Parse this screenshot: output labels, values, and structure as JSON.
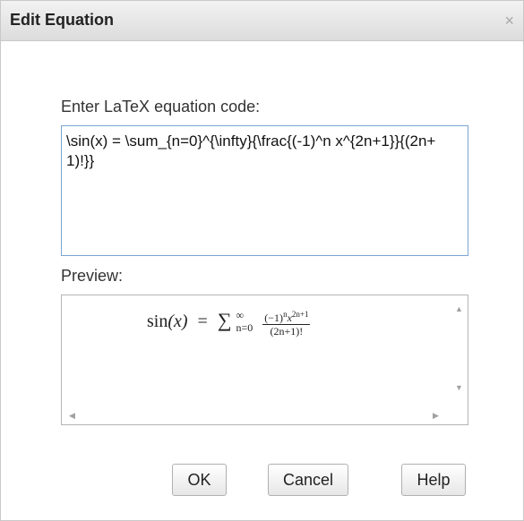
{
  "dialog": {
    "title": "Edit Equation",
    "close_glyph": "×"
  },
  "editor": {
    "label": "Enter LaTeX equation code:",
    "code": "\\sin(x) = \\sum_{n=0}^{\\infty}{\\frac{(-1)^n x^{2n+1}}{(2n+1)!}}"
  },
  "preview": {
    "label": "Preview:",
    "lhs": "sin",
    "lhs_arg": "(x)",
    "equals": "=",
    "sum_symbol": "∑",
    "sum_upper": "∞",
    "sum_lower": "n=0",
    "numerator_base": "(−1)",
    "numerator_exp1": "n",
    "numerator_var": "x",
    "numerator_exp2": "2n+1",
    "denominator": "(2n+1)!"
  },
  "scrollbar": {
    "up_icon": "scroll-up-arrow",
    "down_icon": "scroll-down-arrow",
    "left_icon": "scroll-left-arrow",
    "right_icon": "scroll-right-arrow"
  },
  "buttons": {
    "ok": "OK",
    "cancel": "Cancel",
    "help": "Help"
  }
}
